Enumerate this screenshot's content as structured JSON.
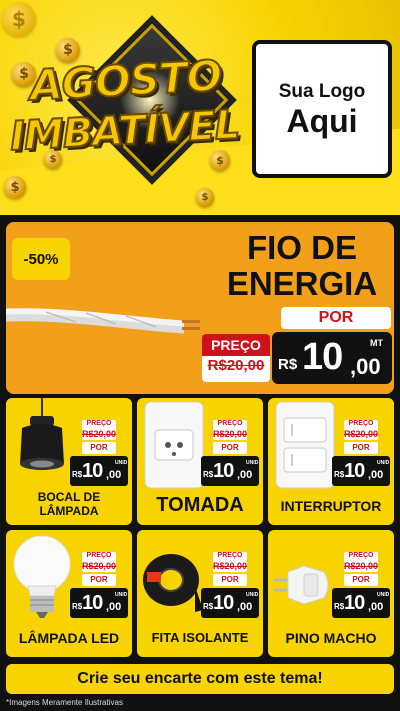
{
  "header": {
    "title_line1": "AGOSTO",
    "title_line2": "IMBATÍVEL",
    "coin_symbol": "$",
    "logo_line1": "Sua Logo",
    "logo_line2": "Aqui"
  },
  "featured": {
    "discount_badge": "-50%",
    "name_line1": "FIO DE",
    "name_line2": "ENERGIA",
    "por_label": "POR",
    "preco_label": "PREÇO",
    "old_price": "R$20,00",
    "currency": "R$",
    "price_int": "10",
    "price_dec": ",00",
    "unit": "MT"
  },
  "products": [
    {
      "name_line1": "BOCAL DE",
      "name_line2": "LÂMPADA",
      "preco_label": "PREÇO",
      "old_price": "R$20,00",
      "por_label": "POR",
      "currency": "R$",
      "price_int": "10",
      "price_dec": ",00",
      "unit": "UNID",
      "image": "lamp-socket"
    },
    {
      "name_line1": "TOMADA",
      "name_line2": "",
      "preco_label": "PREÇO",
      "old_price": "R$20,00",
      "por_label": "POR",
      "currency": "R$",
      "price_int": "10",
      "price_dec": ",00",
      "unit": "UNID",
      "image": "power-outlet"
    },
    {
      "name_line1": "INTERRUPTOR",
      "name_line2": "",
      "preco_label": "PREÇO",
      "old_price": "R$20,00",
      "por_label": "POR",
      "currency": "R$",
      "price_int": "10",
      "price_dec": ",00",
      "unit": "UNID",
      "image": "light-switch"
    },
    {
      "name_line1": "LÂMPADA LED",
      "name_line2": "",
      "preco_label": "PREÇO",
      "old_price": "R$20,00",
      "por_label": "POR",
      "currency": "R$",
      "price_int": "10",
      "price_dec": ",00",
      "unit": "UNID",
      "image": "led-bulb"
    },
    {
      "name_line1": "FITA ISOLANTE",
      "name_line2": "",
      "preco_label": "PREÇO",
      "old_price": "R$20,00",
      "por_label": "POR",
      "currency": "R$",
      "price_int": "10",
      "price_dec": ",00",
      "unit": "UNID",
      "image": "insulating-tape"
    },
    {
      "name_line1": "PINO MACHO",
      "name_line2": "",
      "preco_label": "PREÇO",
      "old_price": "R$20,00",
      "por_label": "POR",
      "currency": "R$",
      "price_int": "10",
      "price_dec": ",00",
      "unit": "UNID",
      "image": "plug"
    }
  ],
  "footer": {
    "cta_text": "Crie seu encarte com este tema!",
    "disclaimer": "*Imagens Meramente Ilustrativas"
  },
  "colors": {
    "yellow": "#f7d400",
    "orange": "#f2a01a",
    "red": "#d0101a",
    "black": "#111111"
  }
}
